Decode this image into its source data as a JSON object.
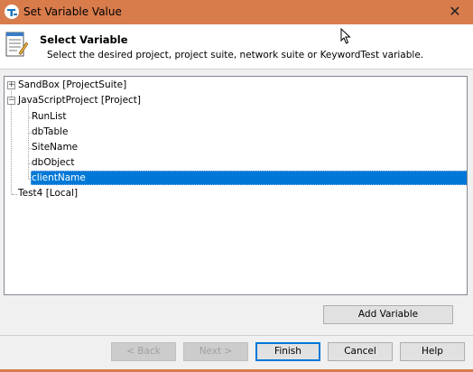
{
  "window": {
    "title": "Set Variable Value",
    "close_glyph": "✕",
    "accent_color": "#d97c4c"
  },
  "header": {
    "title": "Select Variable",
    "description": "Select the desired project, project suite, network suite or KeywordTest variable.",
    "icon": "document-edit-icon"
  },
  "tree": {
    "items": [
      {
        "label": "SandBox [ProjectSuite]",
        "expander": "+"
      },
      {
        "label": "JavaScriptProject [Project]",
        "expander": "−"
      },
      {
        "label": "RunList"
      },
      {
        "label": "dbTable"
      },
      {
        "label": "SiteName"
      },
      {
        "label": "dbObject"
      },
      {
        "label": "clientName",
        "selected": true
      },
      {
        "label": "Test4 [Local]"
      }
    ],
    "selection_color": "#0078d7"
  },
  "buttons": {
    "add_variable": "Add Variable",
    "back": "< Back",
    "next": "Next >",
    "finish": "Finish",
    "cancel": "Cancel",
    "help": "Help"
  }
}
